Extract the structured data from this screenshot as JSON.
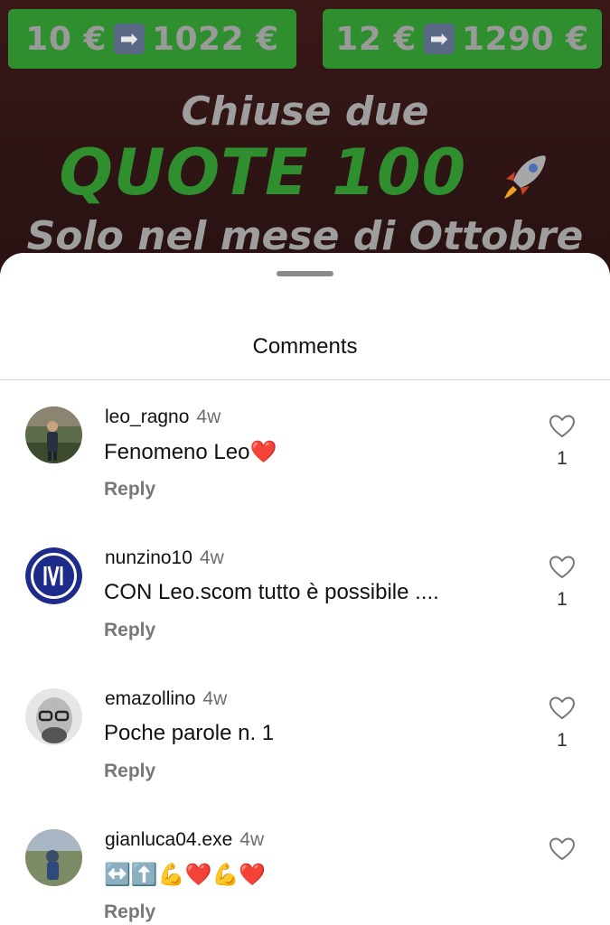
{
  "promo": {
    "pill_left_from": "10 €",
    "pill_left_to": "1022 €",
    "pill_right_from": "12 €",
    "pill_right_to": "1290 €",
    "arrow_glyph": "➡",
    "line1": "Chiuse due",
    "line2": "QUOTE 100",
    "line3": "Solo nel mese di Ottobre"
  },
  "sheet": {
    "title": "Comments"
  },
  "comments": [
    {
      "username": "leo_ragno",
      "time": "4w",
      "text": "Fenomeno Leo❤️",
      "reply": "Reply",
      "likes": "1"
    },
    {
      "username": "nunzino10",
      "time": "4w",
      "text": "CON Leo.scom tutto è possibile ....",
      "reply": "Reply",
      "likes": "1"
    },
    {
      "username": "emazollino",
      "time": "4w",
      "text": "Poche parole n. 1",
      "reply": "Reply",
      "likes": "1"
    },
    {
      "username": "gianluca04.exe",
      "time": "4w",
      "text": "↔️⬆️💪❤️💪❤️",
      "reply": "Reply",
      "likes": ""
    }
  ],
  "colors": {
    "promo_green": "#2f8f2f",
    "promo_gray": "#9e9e9e",
    "background": "#2a1313",
    "sheet": "#ffffff"
  }
}
